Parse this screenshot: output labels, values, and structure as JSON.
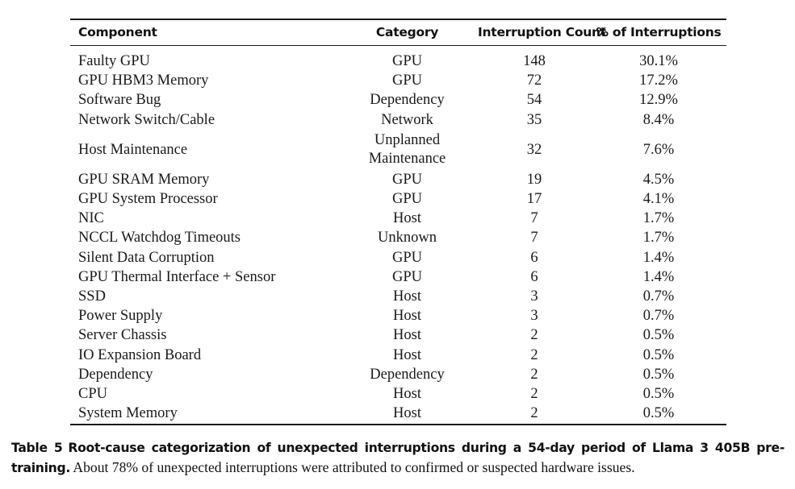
{
  "table": {
    "columns": [
      {
        "key": "component",
        "label": "Component",
        "align": "left"
      },
      {
        "key": "category",
        "label": "Category",
        "align": "center"
      },
      {
        "key": "count",
        "label": "Interruption Count",
        "align": "center"
      },
      {
        "key": "percent",
        "label": "% of Interruptions",
        "align": "center"
      }
    ],
    "rows": [
      {
        "component": "Faulty GPU",
        "category": "GPU",
        "count": "148",
        "percent": "30.1%"
      },
      {
        "component": "GPU HBM3 Memory",
        "category": "GPU",
        "count": "72",
        "percent": "17.2%"
      },
      {
        "component": "Software Bug",
        "category": "Dependency",
        "count": "54",
        "percent": "12.9%"
      },
      {
        "component": "Network Switch/Cable",
        "category": "Network",
        "count": "35",
        "percent": "8.4%"
      },
      {
        "component": "Host Maintenance",
        "category": "Unplanned\nMaintenance",
        "count": "32",
        "percent": "7.6%"
      },
      {
        "component": "GPU SRAM Memory",
        "category": "GPU",
        "count": "19",
        "percent": "4.5%"
      },
      {
        "component": "GPU System Processor",
        "category": "GPU",
        "count": "17",
        "percent": "4.1%"
      },
      {
        "component": "NIC",
        "category": "Host",
        "count": "7",
        "percent": "1.7%"
      },
      {
        "component": "NCCL Watchdog Timeouts",
        "category": "Unknown",
        "count": "7",
        "percent": "1.7%"
      },
      {
        "component": "Silent Data Corruption",
        "category": "GPU",
        "count": "6",
        "percent": "1.4%"
      },
      {
        "component": "GPU Thermal Interface + Sensor",
        "category": "GPU",
        "count": "6",
        "percent": "1.4%"
      },
      {
        "component": "SSD",
        "category": "Host",
        "count": "3",
        "percent": "0.7%"
      },
      {
        "component": "Power Supply",
        "category": "Host",
        "count": "3",
        "percent": "0.7%"
      },
      {
        "component": "Server Chassis",
        "category": "Host",
        "count": "2",
        "percent": "0.5%"
      },
      {
        "component": "IO Expansion Board",
        "category": "Host",
        "count": "2",
        "percent": "0.5%"
      },
      {
        "component": "Dependency",
        "category": "Dependency",
        "count": "2",
        "percent": "0.5%"
      },
      {
        "component": "CPU",
        "category": "Host",
        "count": "2",
        "percent": "0.5%"
      },
      {
        "component": "System Memory",
        "category": "Host",
        "count": "2",
        "percent": "0.5%"
      }
    ]
  },
  "caption": {
    "label": "Table 5",
    "bold_text": "Root-cause categorization of unexpected interruptions during a 54-day period of Llama 3 405B pre-training.",
    "rest_text": "About 78% of unexpected interruptions were attributed to confirmed or suspected hardware issues."
  },
  "chart_data": {
    "type": "table",
    "title": "Root-cause categorization of unexpected interruptions during a 54-day period of Llama 3 405B pre-training",
    "columns": [
      "Component",
      "Category",
      "Interruption Count",
      "% of Interruptions"
    ],
    "components": [
      "Faulty GPU",
      "GPU HBM3 Memory",
      "Software Bug",
      "Network Switch/Cable",
      "Host Maintenance",
      "GPU SRAM Memory",
      "GPU System Processor",
      "NIC",
      "NCCL Watchdog Timeouts",
      "Silent Data Corruption",
      "GPU Thermal Interface + Sensor",
      "SSD",
      "Power Supply",
      "Server Chassis",
      "IO Expansion Board",
      "Dependency",
      "CPU",
      "System Memory"
    ],
    "categories": [
      "GPU",
      "GPU",
      "Dependency",
      "Network",
      "Unplanned Maintenance",
      "GPU",
      "GPU",
      "Host",
      "Unknown",
      "GPU",
      "GPU",
      "Host",
      "Host",
      "Host",
      "Host",
      "Dependency",
      "Host",
      "Host"
    ],
    "interruption_counts": [
      148,
      72,
      54,
      35,
      32,
      19,
      17,
      7,
      7,
      6,
      6,
      3,
      3,
      2,
      2,
      2,
      2,
      2
    ],
    "percent_of_interruptions": [
      30.1,
      17.2,
      12.9,
      8.4,
      7.6,
      4.5,
      4.1,
      1.7,
      1.7,
      1.4,
      1.4,
      0.7,
      0.7,
      0.5,
      0.5,
      0.5,
      0.5,
      0.5
    ]
  }
}
